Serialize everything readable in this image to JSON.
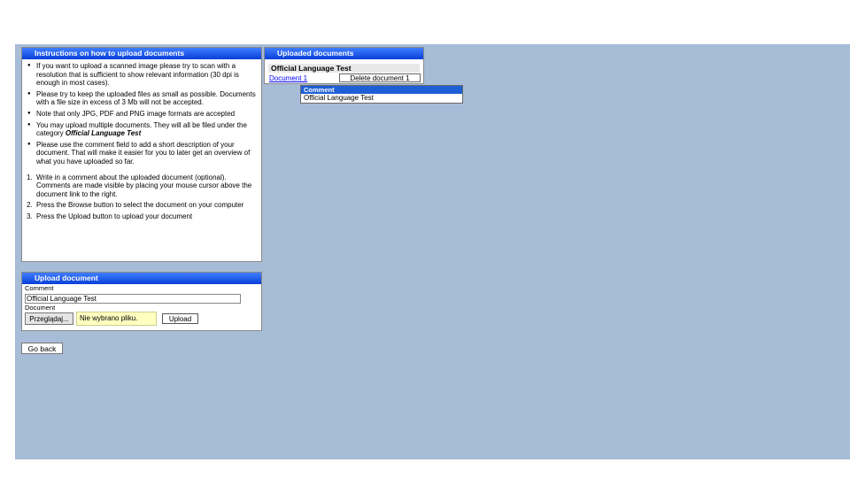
{
  "instructions": {
    "title": "Instructions on how to upload documents",
    "bullets": [
      "If you want to upload a scanned image please try to scan with a resolution that is sufficient to show relevant information (30 dpi is enough in most cases).",
      "Please try to keep the uploaded files as small as possible. Documents with a file size in excess of 3 Mb will not be accepted.",
      "Note that only JPG, PDF and PNG image formats are accepted",
      "You may upload multiple documents. They will all be filed under the category",
      "Please use the comment field to add a short description of your document. That will make it easier for you to later get an overview of what you have uploaded so far."
    ],
    "category_name": "Official Language Test",
    "steps": [
      "Write in a comment about the uploaded document (optional). Comments are made visible by placing your mouse cursor above the document link to the right.",
      "Press the Browse button to select the document on your computer",
      "Press the Upload button to upload your document"
    ],
    "step_numbers": [
      "1.",
      "2.",
      "3."
    ]
  },
  "uploaded": {
    "title": "Uploaded documents",
    "category_title": "Official Language Test",
    "documents": [
      {
        "link_text": "Document 1",
        "delete_label": "Delete document 1"
      }
    ]
  },
  "tooltip": {
    "header": "Comment",
    "body": "Official Language Test"
  },
  "upload": {
    "title": "Upload document",
    "comment_label": "Comment",
    "comment_value": "Official Language Test",
    "document_label": "Document",
    "browse_label": "Przeglądaj...",
    "file_status": "Nie wybrano pliku.",
    "upload_label": "Upload"
  },
  "go_back_label": "Go back",
  "colors": {
    "background": "#a7bcd6",
    "header_blue": "#0a3fd8",
    "link": "#0000ff",
    "file_status_bg": "#ffffc0"
  }
}
